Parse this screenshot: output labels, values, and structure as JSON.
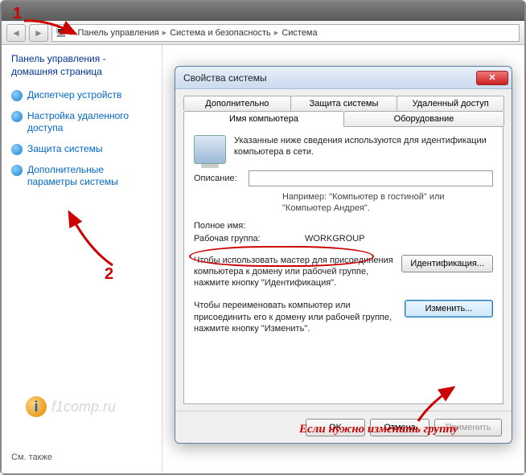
{
  "annotations": {
    "num1": "1",
    "num2": "2",
    "red_note": "Если нужно изменить группу"
  },
  "breadcrumb": {
    "item1": "Панель управления",
    "item2": "Система и безопасность",
    "item3": "Система"
  },
  "sidebar": {
    "title": "Панель управления - домашняя страница",
    "links": {
      "l0": "Диспетчер устройств",
      "l1": "Настройка удаленного доступа",
      "l2": "Защита системы",
      "l3": "Дополнительные параметры системы"
    },
    "see_also": "См. также"
  },
  "dialog": {
    "title": "Свойства системы",
    "tabs": {
      "t_adv": "Дополнительно",
      "t_prot": "Защита системы",
      "t_remote": "Удаленный доступ",
      "t_name": "Имя компьютера",
      "t_hw": "Оборудование"
    },
    "intro": "Указанные ниже сведения используются для идентификации компьютера в сети.",
    "desc_label": "Описание:",
    "example": "Например: \"Компьютер в гостиной\" или \"Компьютер Андрея\".",
    "fullname_label": "Полное имя:",
    "workgroup_label": "Рабочая группа:",
    "workgroup_value": "WORKGROUP",
    "ident_text": "Чтобы использовать мастер для присоединения компьютера к домену или рабочей группе, нажмите кнопку \"Идентификация\".",
    "ident_btn": "Идентификация...",
    "change_text": "Чтобы переименовать компьютер или присоединить его к домену или рабочей группе, нажмите кнопку \"Изменить\".",
    "change_btn": "Изменить...",
    "ok": "OK",
    "cancel": "Отмена",
    "apply": "Применить"
  },
  "watermark": "f1comp.ru"
}
